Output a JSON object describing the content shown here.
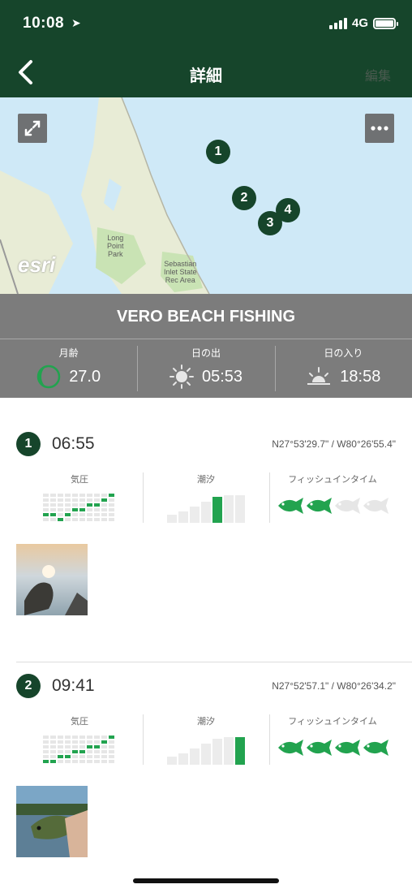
{
  "status": {
    "time": "10:08",
    "network": "4G"
  },
  "nav": {
    "title": "詳細",
    "edit_label": "編集"
  },
  "map": {
    "markers": [
      "1",
      "2",
      "3",
      "4"
    ],
    "watermark": "esri",
    "labels": {
      "park": "Long\nPoint\nPark",
      "rec_area": "Sebastian\nInlet State\nRec Area"
    }
  },
  "trip": {
    "title": "VERO BEACH FISHING",
    "moon": {
      "label": "月齢",
      "value": "27.0"
    },
    "sunrise": {
      "label": "日の出",
      "value": "05:53"
    },
    "sunset": {
      "label": "日の入り",
      "value": "18:58"
    }
  },
  "metric_labels": {
    "pressure": "気圧",
    "tide": "潮汐",
    "fish_time": "フィッシュインタイム"
  },
  "entries": [
    {
      "number": "1",
      "time": "06:55",
      "coords": "N27°53'29.7\" / W80°26'55.4\"",
      "fish_rating": 2,
      "fish_max": 4,
      "tide_level": 4
    },
    {
      "number": "2",
      "time": "09:41",
      "coords": "N27°52'57.1\" / W80°26'34.2\"",
      "fish_rating": 4,
      "fish_max": 4,
      "tide_level": 6
    }
  ],
  "colors": {
    "header": "#16452b",
    "accent": "#22a34f",
    "trip_bar": "#7c7c7c",
    "map_water": "#cfe9f7"
  }
}
